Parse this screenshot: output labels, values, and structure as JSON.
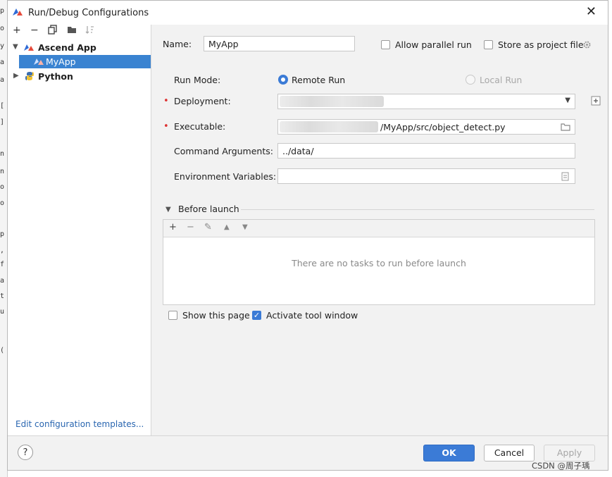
{
  "window": {
    "title": "Run/Debug Configurations"
  },
  "left_edge_chars": [
    "p",
    "o",
    "y",
    "a",
    "a",
    "[",
    "]",
    "n",
    "n",
    "o",
    "o",
    "p",
    ",",
    "f",
    "a",
    "t",
    "u",
    "("
  ],
  "toolbar_icons": [
    "add-icon",
    "remove-icon",
    "copy-icon",
    "folder-move-icon",
    "sort-icon"
  ],
  "tree": {
    "group_ascend": "Ascend App",
    "item_myapp": "MyApp",
    "group_python": "Python"
  },
  "left_footer": {
    "edit_templates": "Edit configuration templates..."
  },
  "form": {
    "name_label": "Name:",
    "name_value": "MyApp",
    "allow_parallel": "Allow parallel run",
    "store_project": "Store as project file",
    "run_mode_label": "Run Mode:",
    "remote_run": "Remote Run",
    "local_run": "Local Run",
    "deployment_label": "Deployment:",
    "executable_label": "Executable:",
    "executable_value": "/MyApp/src/object_detect.py",
    "command_args_label": "Command Arguments:",
    "command_args_value": "../data/",
    "env_vars_label": "Environment Variables:",
    "env_vars_value": ""
  },
  "before_launch": {
    "label": "Before launch",
    "empty_text": "There are no tasks to run before launch",
    "show_page": "Show this page",
    "activate_tool": "Activate tool window"
  },
  "buttons": {
    "ok": "OK",
    "cancel": "Cancel",
    "apply": "Apply",
    "help": "?"
  },
  "watermark": "CSDN @周子瑀",
  "colors": {
    "accent": "#3b7bd6",
    "selection": "#3a83d1",
    "required": "#dd3333",
    "link": "#2a66b0"
  }
}
